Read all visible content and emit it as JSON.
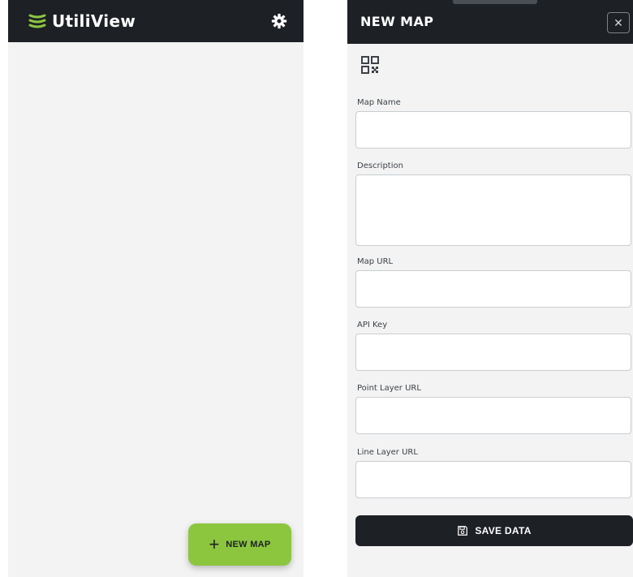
{
  "app": {
    "name": "UtiliView",
    "accent_color": "#8cc63f",
    "dark_color": "#1d2025"
  },
  "home": {
    "settings_icon": "gear-icon",
    "fab": {
      "icon": "plus-icon",
      "label": "NEW MAP"
    }
  },
  "modal": {
    "title": "NEW MAP",
    "close_icon": "close-icon",
    "close_glyph": "✕",
    "qr_icon": "qr-code-icon",
    "fields": {
      "map_name": {
        "label": "Map Name",
        "value": ""
      },
      "description": {
        "label": "Description",
        "value": ""
      },
      "map_url": {
        "label": "Map URL",
        "value": ""
      },
      "api_key": {
        "label": "API Key",
        "value": ""
      },
      "point_layer_url": {
        "label": "Point Layer URL",
        "value": ""
      },
      "line_layer_url": {
        "label": "Line Layer URL",
        "value": ""
      }
    },
    "save": {
      "icon": "save-icon",
      "label": "SAVE DATA"
    }
  }
}
